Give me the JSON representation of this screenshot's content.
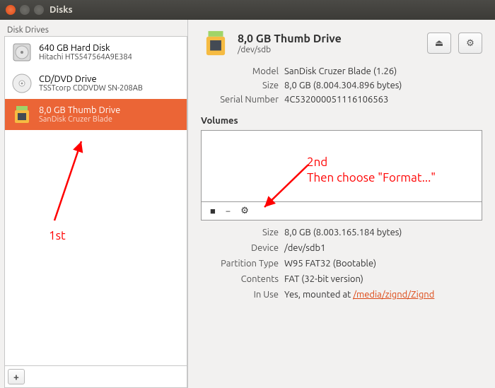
{
  "window": {
    "title": "Disks"
  },
  "sidebar": {
    "label": "Disk Drives",
    "items": [
      {
        "title": "640 GB Hard Disk",
        "sub": "Hitachi HTS547564A9E384"
      },
      {
        "title": "CD/DVD Drive",
        "sub": "TSSTcorp CDDVDW SN-208AB"
      },
      {
        "title": "8,0 GB Thumb Drive",
        "sub": "SanDisk Cruzer Blade"
      }
    ]
  },
  "header": {
    "title": "8,0 GB Thumb Drive",
    "sub": "/dev/sdb"
  },
  "info": {
    "model_label": "Model",
    "model_value": "SanDisk Cruzer Blade (1.26)",
    "size_label": "Size",
    "size_value": "8,0 GB (8.004.304.896 bytes)",
    "serial_label": "Serial Number",
    "serial_value": "4C532000051116106563"
  },
  "volumes_label": "Volumes",
  "vol_info": {
    "size_label": "Size",
    "size_value": "8,0 GB (8.003.165.184 bytes)",
    "device_label": "Device",
    "device_value": "/dev/sdb1",
    "ptype_label": "Partition Type",
    "ptype_value": "W95 FAT32 (Bootable)",
    "contents_label": "Contents",
    "contents_value": "FAT (32-bit version)",
    "inuse_label": "In Use",
    "inuse_prefix": "Yes, mounted at ",
    "inuse_link": "/media/zignd/Zignd"
  },
  "annotations": {
    "first": "1st",
    "second_a": "2nd",
    "second_b": "Then choose \"Format...\""
  }
}
